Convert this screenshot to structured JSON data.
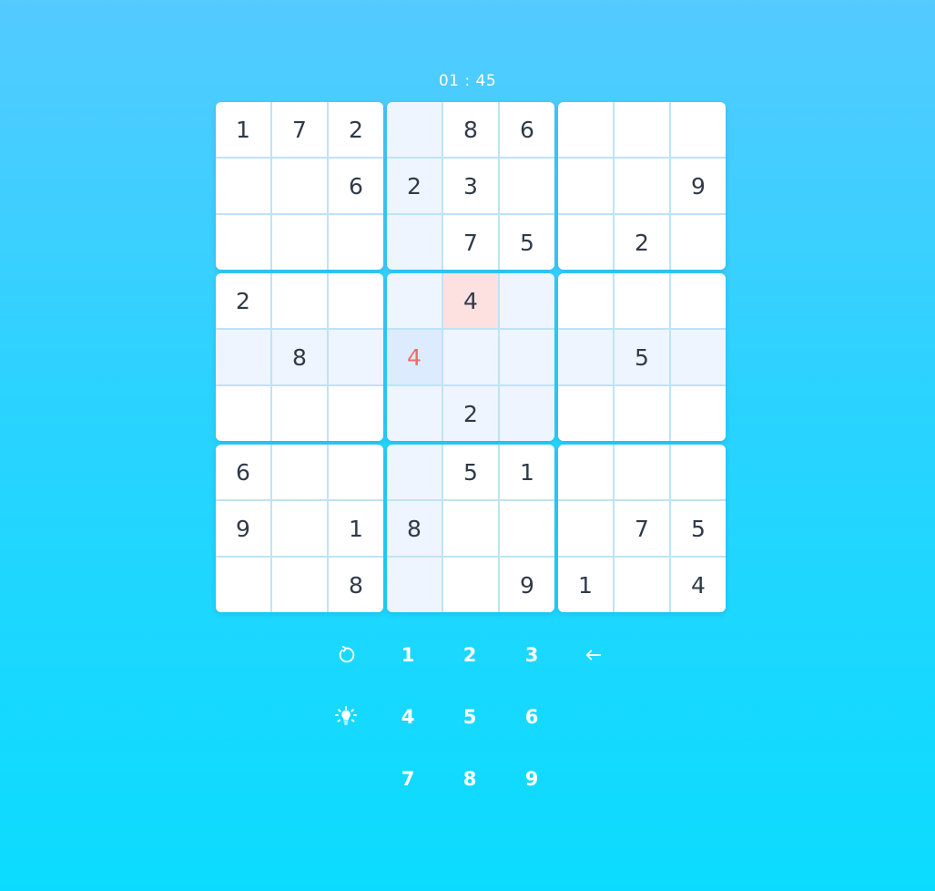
{
  "timer": {
    "text": "01 : 45"
  },
  "board": {
    "rows": [
      [
        "1",
        "7",
        "2",
        "",
        "8",
        "6",
        "",
        "",
        ""
      ],
      [
        "",
        "",
        "6",
        "2",
        "3",
        "",
        "",
        "",
        "9"
      ],
      [
        "",
        "",
        "",
        "",
        "7",
        "5",
        "",
        "2",
        ""
      ],
      [
        "2",
        "",
        "",
        "",
        "4",
        "",
        "",
        "",
        ""
      ],
      [
        "",
        "8",
        "",
        "4",
        "",
        "",
        "",
        "5",
        ""
      ],
      [
        "",
        "",
        "",
        "",
        "2",
        "",
        "",
        "",
        ""
      ],
      [
        "6",
        "",
        "",
        "",
        "5",
        "1",
        "",
        "",
        ""
      ],
      [
        "9",
        "",
        "1",
        "8",
        "",
        "",
        "",
        "7",
        "5"
      ],
      [
        "",
        "",
        "8",
        "",
        "",
        "9",
        "1",
        "",
        "4"
      ]
    ],
    "selected": {
      "row": 4,
      "col": 3
    },
    "conflicts": [
      {
        "row": 3,
        "col": 4
      }
    ],
    "user_errors": [
      {
        "row": 4,
        "col": 3
      }
    ]
  },
  "keypad": {
    "undo_icon": "undo-icon",
    "hint_icon": "lightbulb-icon",
    "erase_icon": "backspace-arrow-icon",
    "digits": [
      "1",
      "2",
      "3",
      "4",
      "5",
      "6",
      "7",
      "8",
      "9"
    ]
  },
  "colors": {
    "background_top": "#54caff",
    "background_bottom": "#0bdcff",
    "cell": "#ffffff",
    "highlight": "#eef5fe",
    "selected": "#dcebfd",
    "conflict": "#fde1e1",
    "error_text": "#f06b6b",
    "digit_text": "#2f3a4a"
  }
}
